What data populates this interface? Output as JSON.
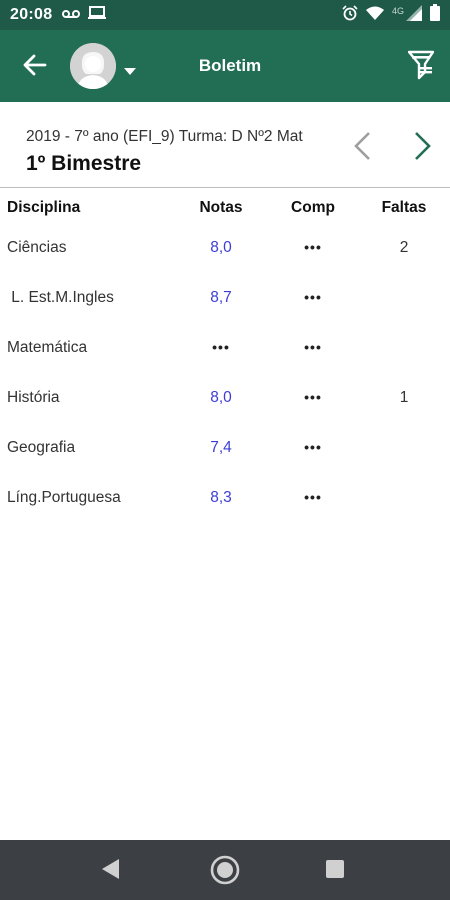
{
  "status_bar": {
    "time": "20:08",
    "network_label": "4G",
    "icons": [
      "voicemail-icon",
      "laptop-icon",
      "alarm-icon",
      "wifi-icon",
      "signal-icon",
      "battery-icon"
    ]
  },
  "app_bar": {
    "title": "Boletim",
    "back_icon": "arrow-left-icon",
    "filter_icon": "filter-icon",
    "avatar_icon": "avatar-placeholder"
  },
  "period": {
    "subtitle": "2019 - 7º ano (EFI_9) Turma: D Nº2 Mat",
    "title": "1º Bimestre"
  },
  "table": {
    "headers": {
      "discipline": "Disciplina",
      "grades": "Notas",
      "comp": "Comp",
      "absences": "Faltas"
    },
    "rows": [
      {
        "discipline": "Ciências",
        "grade": "8,0",
        "comp": "•••",
        "absences": "2"
      },
      {
        "discipline": " L. Est.M.Ingles",
        "grade": "8,7",
        "comp": "•••",
        "absences": ""
      },
      {
        "discipline": "Matemática",
        "grade": "•••",
        "comp": "•••",
        "absences": ""
      },
      {
        "discipline": "História",
        "grade": "8,0",
        "comp": "•••",
        "absences": "1"
      },
      {
        "discipline": "Geografia",
        "grade": "7,4",
        "comp": "•••",
        "absences": ""
      },
      {
        "discipline": "Líng.Portuguesa",
        "grade": "8,3",
        "comp": "•••",
        "absences": ""
      }
    ]
  },
  "colors": {
    "status_bar": "#1e5a47",
    "app_bar": "#226e54",
    "grade_text": "#3d3dd6",
    "nav_bar": "#3c3f44"
  }
}
